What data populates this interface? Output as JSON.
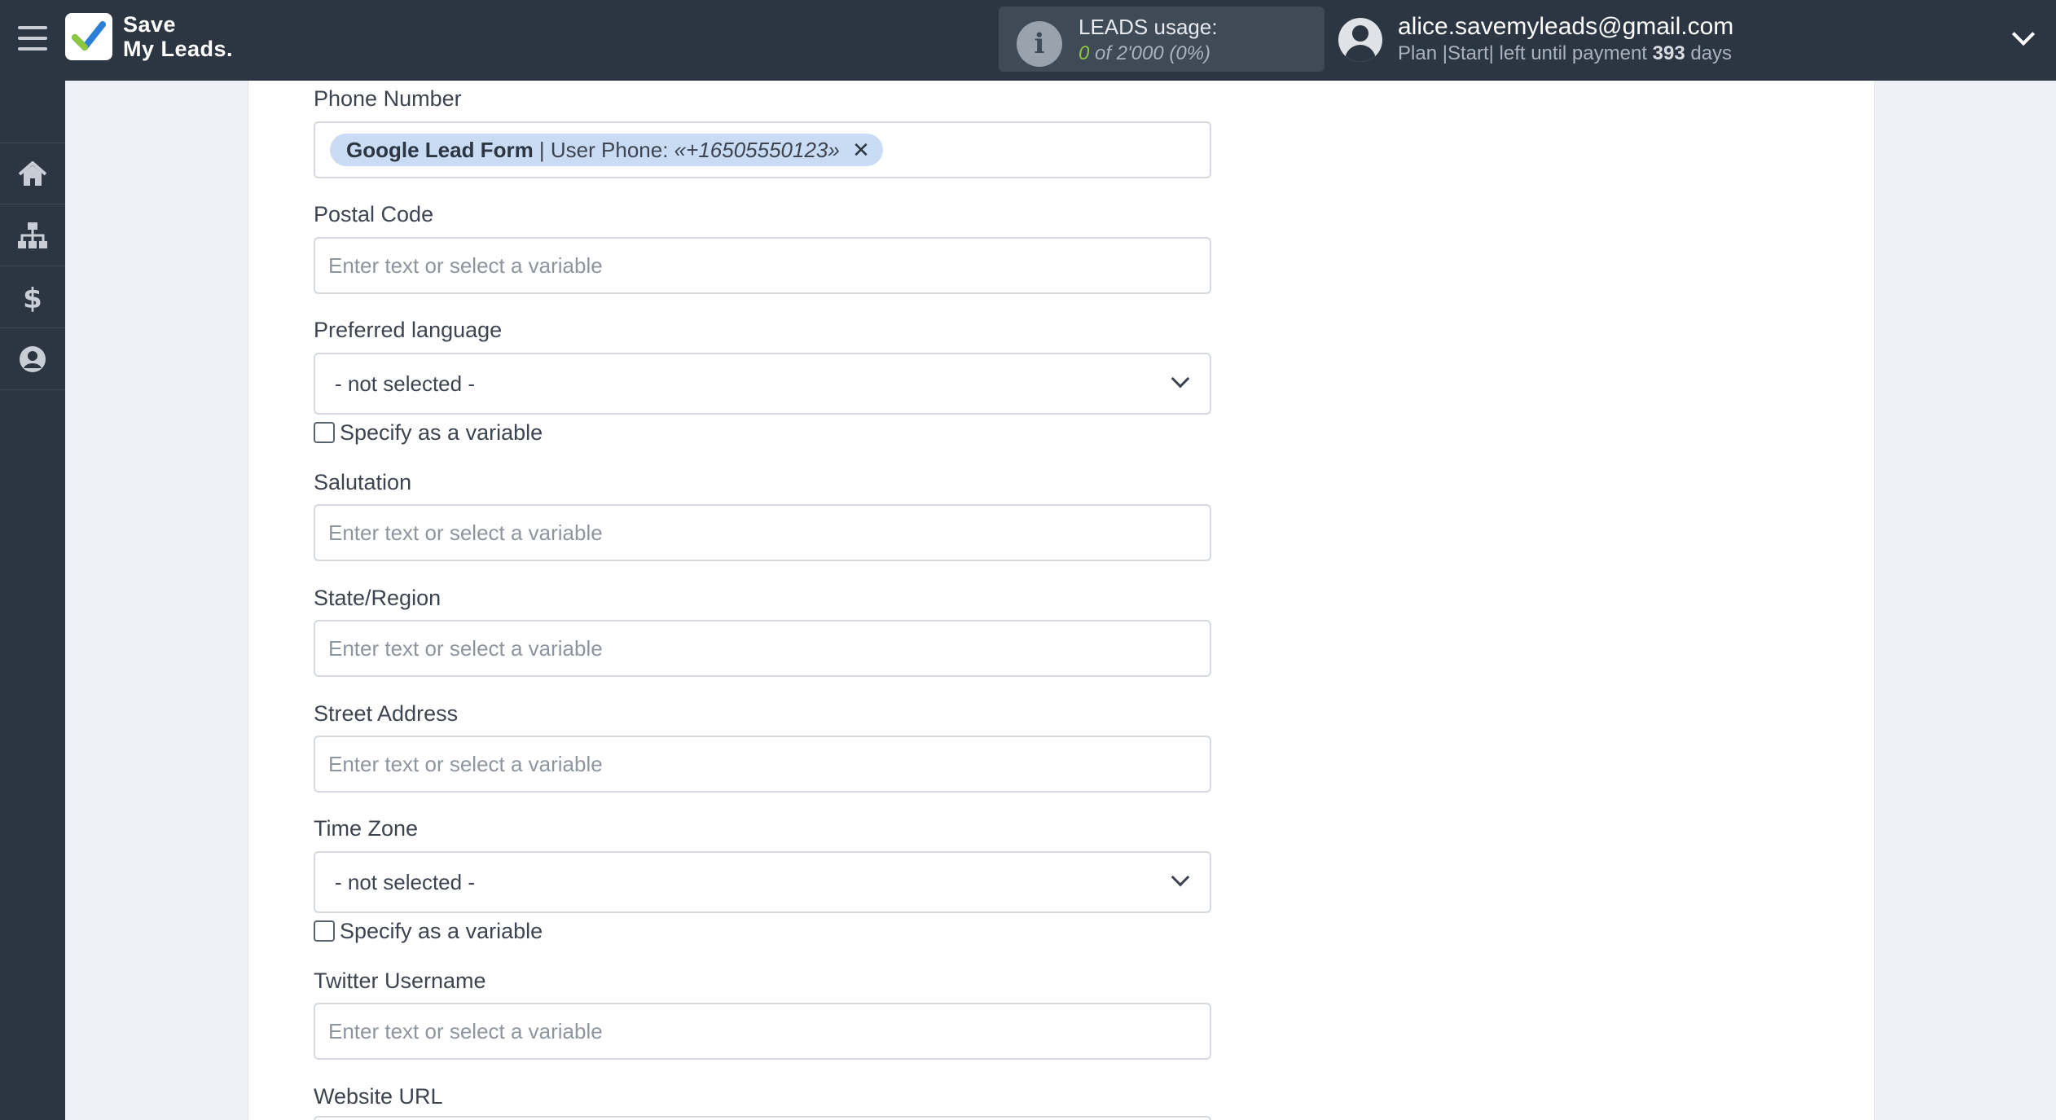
{
  "brand": {
    "line1": "Save",
    "line2": "My Leads."
  },
  "usage": {
    "title": "LEADS usage:",
    "value": "0",
    "of_text": "of 2'000",
    "percent": "(0%)"
  },
  "account": {
    "email": "alice.savemyleads@gmail.com",
    "plan_prefix": "Plan |Start| left until payment",
    "days_number": "393",
    "days_suffix": "days"
  },
  "sidebar": {
    "items": [
      {
        "icon": "home-icon"
      },
      {
        "icon": "sitemap-icon"
      },
      {
        "icon": "dollar-icon"
      },
      {
        "icon": "user-circle-icon"
      }
    ]
  },
  "form": {
    "phone_number": {
      "label": "Phone Number",
      "tag_source": "Google Lead Form",
      "tag_field": "| User Phone:",
      "tag_value": "«+16505550123»",
      "tag_remove": "✕"
    },
    "postal_code": {
      "label": "Postal Code",
      "placeholder": "Enter text or select a variable"
    },
    "preferred_language": {
      "label": "Preferred language",
      "selected": "- not selected -",
      "checkbox_label": "Specify as a variable"
    },
    "salutation": {
      "label": "Salutation",
      "placeholder": "Enter text or select a variable"
    },
    "state_region": {
      "label": "State/Region",
      "placeholder": "Enter text or select a variable"
    },
    "street_address": {
      "label": "Street Address",
      "placeholder": "Enter text or select a variable"
    },
    "time_zone": {
      "label": "Time Zone",
      "selected": "- not selected -",
      "checkbox_label": "Specify as a variable"
    },
    "twitter_username": {
      "label": "Twitter Username",
      "placeholder": "Enter text or select a variable"
    },
    "website_url": {
      "label": "Website URL"
    }
  },
  "colors": {
    "topbar": "#2c3643",
    "accent_green": "#8dc63f",
    "tag_bg": "#c9dcf3"
  }
}
